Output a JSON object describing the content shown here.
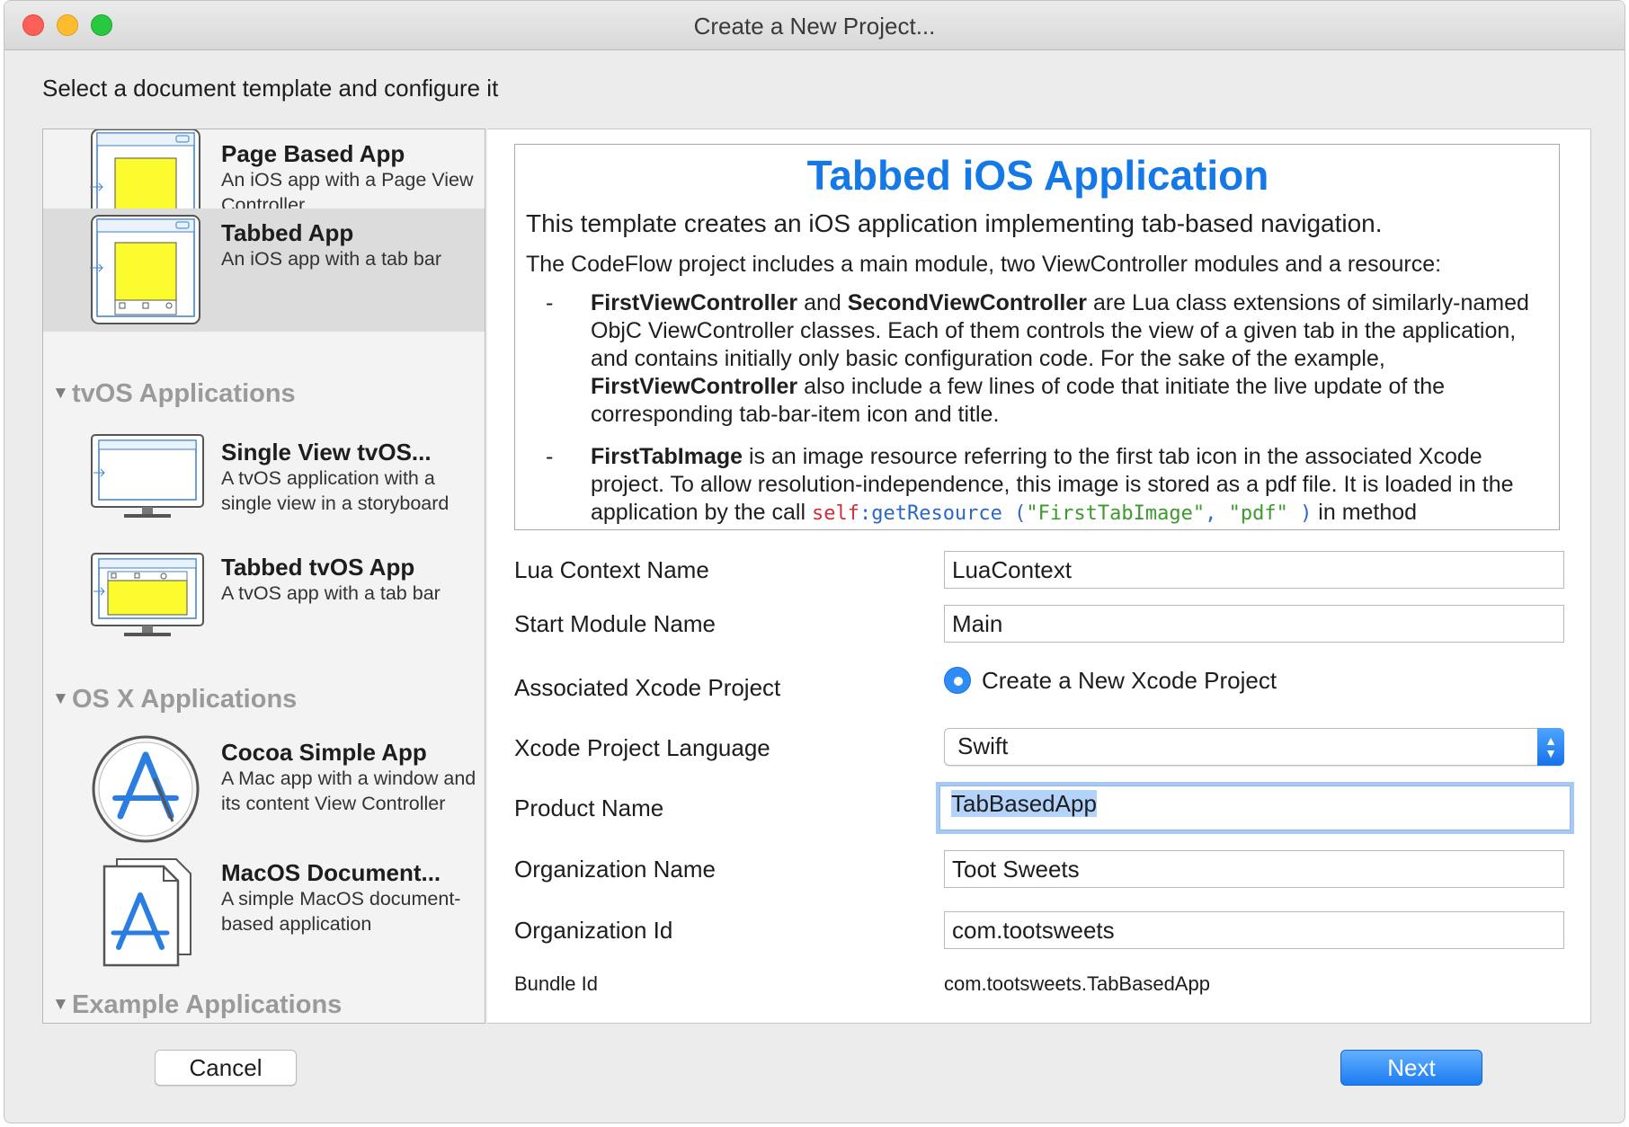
{
  "window": {
    "title": "Create a New Project..."
  },
  "subtitle": "Select a document template and configure it",
  "templates": {
    "ios_items": [
      {
        "name": "Page Based App",
        "desc": "An iOS app with a Page View Controller"
      },
      {
        "name": "Tabbed App",
        "desc": "An iOS app with a tab bar"
      }
    ],
    "sections": {
      "tvos": "tvOS Applications",
      "osx": "OS X Applications",
      "examples": "Example Applications"
    },
    "tvos_items": [
      {
        "name": "Single View tvOS...",
        "desc": "A tvOS application with a single view in a storyboard"
      },
      {
        "name": "Tabbed tvOS App",
        "desc": "A tvOS app with a tab bar"
      }
    ],
    "osx_items": [
      {
        "name": "Cocoa Simple App",
        "desc": "A Mac app with a window and its content View Controller"
      },
      {
        "name": "MacOS Document...",
        "desc": "A simple MacOS document-based application"
      }
    ],
    "selected": "Tabbed App"
  },
  "description": {
    "title": "Tabbed iOS Application",
    "intro": "This template creates an iOS application implementing tab-based navigation.",
    "sub": "The CodeFlow project includes a main module, two ViewController modules and a resource:",
    "bullet_dash": "-",
    "bullet1": {
      "name_a": "FirstViewController",
      "and": " and ",
      "name_b": "SecondViewController",
      "text1": " are Lua class extensions of similarly-named ObjC ViewController classes. Each of them controls the view of a given tab in the application, and contains initially only basic configuration code. For the sake of the example, ",
      "name_c": "FirstViewController",
      "text2": " also include a few lines of code that initiate the live update of the corresponding  tab-bar-item icon and title."
    },
    "bullet2": {
      "name": "FirstTabImage",
      "text": " is an image resource referring to the first tab icon in the associated Xcode project. To allow resolution-independence, this image is stored as a pdf file. It is loaded in the application by the call ",
      "code_self": "self",
      "code_colon": ":",
      "code_func": "getResource",
      "code_open": " (",
      "code_arg1": "\"FirstTabImage\"",
      "code_comma": ", ",
      "code_arg2": "\"pdf\"",
      "code_close": "   )",
      "text_end": " in method"
    }
  },
  "form": {
    "lua_context_label": "Lua Context Name",
    "lua_context_value": "LuaContext",
    "start_module_label": "Start Module Name",
    "start_module_value": "Main",
    "xcode_project_label": "Associated Xcode Project",
    "xcode_project_option": "Create a New Xcode Project",
    "language_label": "Xcode Project Language",
    "language_value": "Swift",
    "product_name_label": "Product Name",
    "product_name_value": "TabBasedApp",
    "org_name_label": "Organization Name",
    "org_name_value": "Toot Sweets",
    "org_id_label": "Organization Id",
    "org_id_value": "com.tootsweets",
    "bundle_id_label": "Bundle Id",
    "bundle_id_value": "com.tootsweets.TabBasedApp"
  },
  "buttons": {
    "cancel": "Cancel",
    "next": "Next"
  },
  "colors": {
    "accent": "#1479e6",
    "thumb_screen": "#fbfb2e",
    "next_button": "#1b7cf2"
  }
}
